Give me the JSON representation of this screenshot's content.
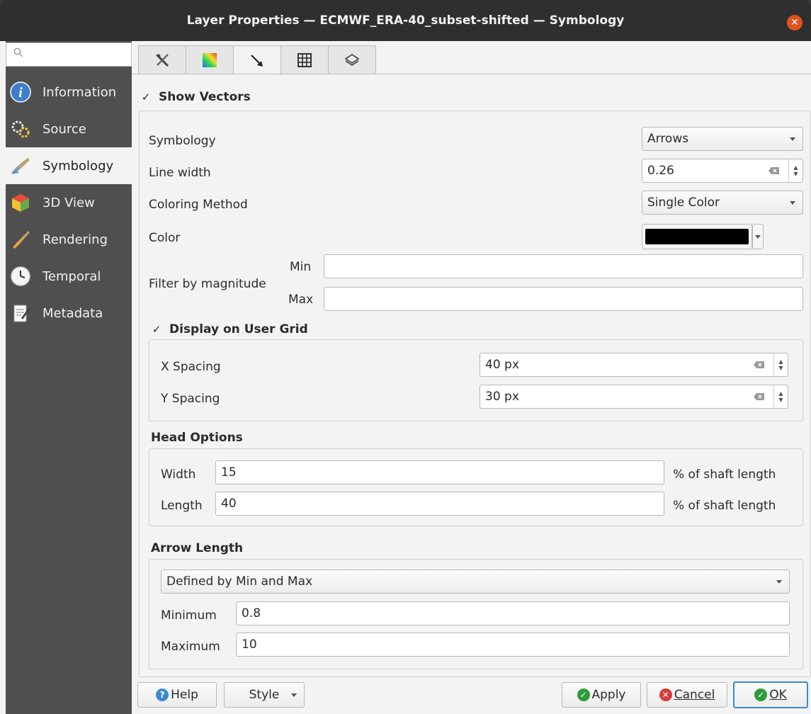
{
  "window": {
    "title": "Layer Properties — ECMWF_ERA-40_subset-shifted — Symbology"
  },
  "sidebar": {
    "search_placeholder": "",
    "items": [
      {
        "label": "Information",
        "icon": "info-icon"
      },
      {
        "label": "Source",
        "icon": "source-icon"
      },
      {
        "label": "Symbology",
        "icon": "symbology-icon",
        "active": true
      },
      {
        "label": "3D View",
        "icon": "cube-icon"
      },
      {
        "label": "Rendering",
        "icon": "brush-icon"
      },
      {
        "label": "Temporal",
        "icon": "clock-icon"
      },
      {
        "label": "Metadata",
        "icon": "metadata-icon"
      }
    ]
  },
  "tabs": [
    "settings-tab",
    "contours-tab",
    "vectors-tab",
    "mesh-tab",
    "stacked-tab"
  ],
  "vectors": {
    "show_vectors_label": "Show Vectors",
    "show_vectors_checked": true,
    "symbology_label": "Symbology",
    "symbology_value": "Arrows",
    "line_width_label": "Line width",
    "line_width_value": "0.26",
    "coloring_label": "Coloring Method",
    "coloring_value": "Single Color",
    "color_label": "Color",
    "color_value": "#000000",
    "filter_label": "Filter by magnitude",
    "min_label": "Min",
    "max_label": "Max",
    "min_value": "",
    "max_value": ""
  },
  "user_grid": {
    "label": "Display on User Grid",
    "checked": true,
    "x_label": "X Spacing",
    "x_value": "40 px",
    "y_label": "Y Spacing",
    "y_value": "30 px"
  },
  "head_options": {
    "title": "Head Options",
    "width_label": "Width",
    "width_value": "15",
    "length_label": "Length",
    "length_value": "40",
    "unit": "% of shaft length"
  },
  "arrow_length": {
    "title": "Arrow Length",
    "method_value": "Defined by Min and Max",
    "minimum_label": "Minimum",
    "minimum_value": "0.8",
    "maximum_label": "Maximum",
    "maximum_value": "10"
  },
  "buttons": {
    "help": "Help",
    "style": "Style",
    "apply": "Apply",
    "cancel": "Cancel",
    "ok": "OK"
  },
  "colors": {
    "accent": "#3a8bd0",
    "ok_green": "#2e9b3a",
    "cancel_red": "#d83a3a",
    "close_orange": "#e2521d"
  }
}
